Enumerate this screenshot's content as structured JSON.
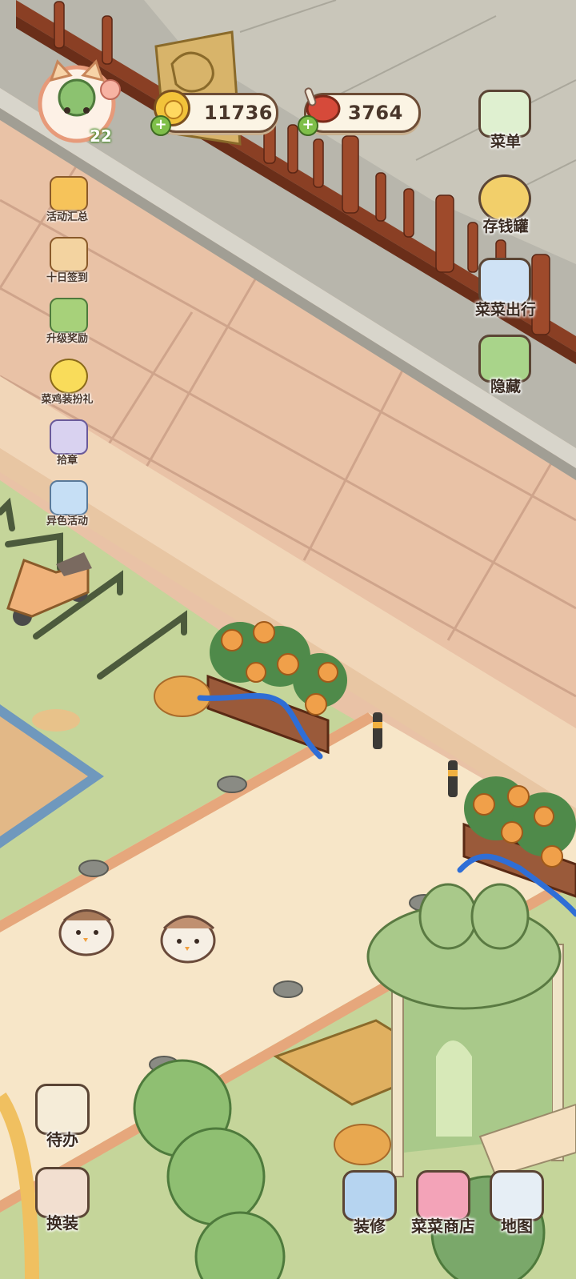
{
  "hud": {
    "coins": "11736",
    "meat": "3764",
    "level": "22"
  },
  "left_menu": [
    {
      "label": "活动汇总",
      "icon": "event-summary-icon"
    },
    {
      "label": "十日签到",
      "icon": "checkin-icon"
    },
    {
      "label": "升级奖励",
      "icon": "levelup-reward-icon"
    },
    {
      "label": "菜鸡装扮礼",
      "icon": "chick-costume-icon"
    },
    {
      "label": "拾章",
      "icon": "stamp-icon"
    },
    {
      "label": "异色活动",
      "icon": "color-event-icon"
    }
  ],
  "right_menu": [
    {
      "label": "菜单",
      "icon": "menu-icon"
    },
    {
      "label": "存钱罐",
      "icon": "piggy-bank-icon"
    },
    {
      "label": "菜菜出行",
      "icon": "travel-icon"
    },
    {
      "label": "隐藏",
      "icon": "hide-icon"
    }
  ],
  "bottom_left": [
    {
      "label": "待办",
      "icon": "todo-icon"
    },
    {
      "label": "换装",
      "icon": "dress-up-icon"
    }
  ],
  "bottom_right": [
    {
      "label": "装修",
      "icon": "decorate-icon"
    },
    {
      "label": "菜菜商店",
      "icon": "shop-icon"
    },
    {
      "label": "地图",
      "icon": "map-icon"
    }
  ],
  "colors": {
    "plaza_tile": "#e9c2a6",
    "grass": "#c5d59a",
    "path": "#f7e6c8",
    "fence": "#8a3f24",
    "pavement": "#b5b2a7"
  }
}
